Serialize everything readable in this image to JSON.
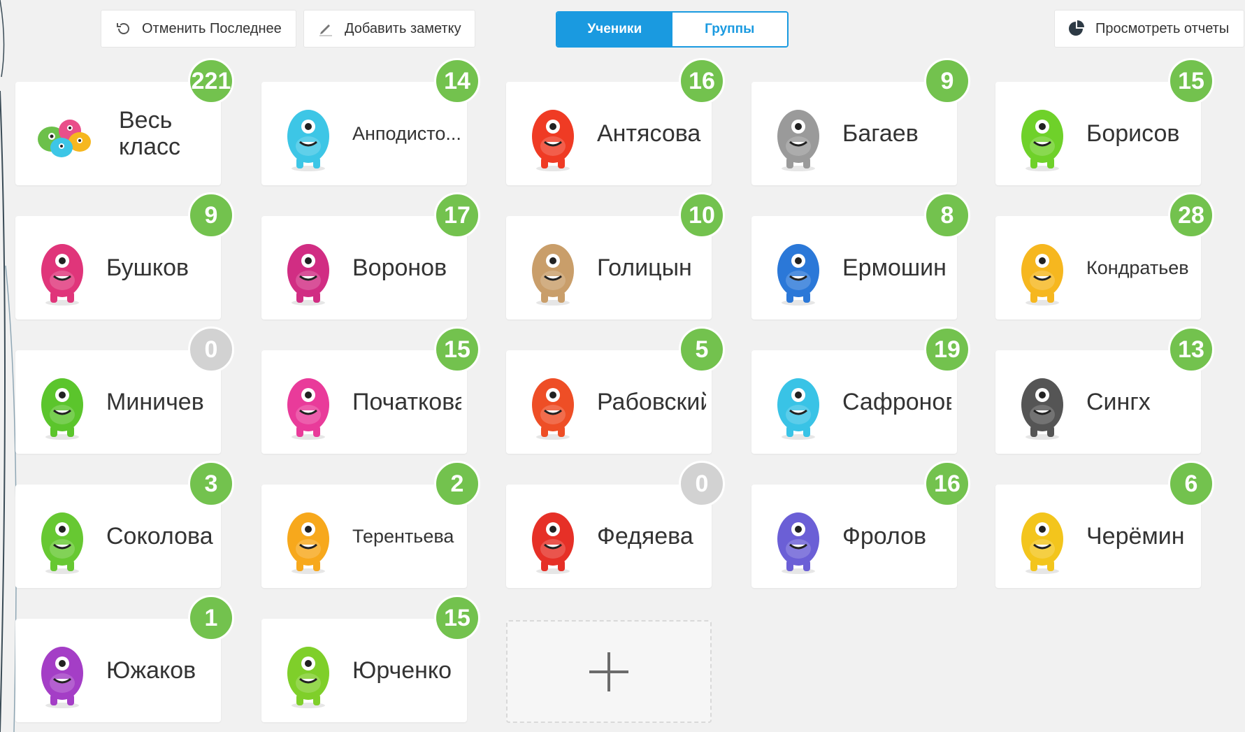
{
  "toolbar": {
    "undo_label": "Отменить Последнее",
    "note_label": "Добавить заметку",
    "reports_label": "Просмотреть отчеты",
    "tab_students": "Ученики",
    "tab_groups": "Группы"
  },
  "colors": {
    "accent": "#1a9ae0",
    "badge_positive": "#73c24e",
    "badge_zero": "#d2d2d2"
  },
  "cards": [
    {
      "name": "Весь класс",
      "points": "221",
      "avatar": "whole-class-monsters",
      "color": "#6cc04a"
    },
    {
      "name": "Анподисто...",
      "points": "14",
      "avatar": "cyan-monster",
      "color": "#3dc6e6"
    },
    {
      "name": "Антясова",
      "points": "16",
      "avatar": "red-monster",
      "color": "#ef3b24"
    },
    {
      "name": "Багаев",
      "points": "9",
      "avatar": "gray-cow-monster",
      "color": "#9a9a9a"
    },
    {
      "name": "Борисов",
      "points": "15",
      "avatar": "green-alien-monster",
      "color": "#6fd12a"
    },
    {
      "name": "Бушков",
      "points": "9",
      "avatar": "pink-cyclops-monster",
      "color": "#e0357a"
    },
    {
      "name": "Воронов",
      "points": "17",
      "avatar": "magenta-monster",
      "color": "#d12d83"
    },
    {
      "name": "Голицын",
      "points": "10",
      "avatar": "cow-monster",
      "color": "#c99e6a"
    },
    {
      "name": "Ермошин",
      "points": "8",
      "avatar": "blue-monster",
      "color": "#2b78d8"
    },
    {
      "name": "Кондратьев",
      "points": "28",
      "avatar": "yellow-monster",
      "color": "#f6b71f"
    },
    {
      "name": "Миничев",
      "points": "0",
      "avatar": "green-fanged-monster",
      "color": "#5bc52c"
    },
    {
      "name": "Початкова",
      "points": "15",
      "avatar": "pink-furry-monster",
      "color": "#e93b9a"
    },
    {
      "name": "Рабовский",
      "points": "5",
      "avatar": "orange-monster",
      "color": "#ee4e26"
    },
    {
      "name": "Сафронов",
      "points": "19",
      "avatar": "light-blue-monster",
      "color": "#39c3e6"
    },
    {
      "name": "Сингх",
      "points": "13",
      "avatar": "dark-gray-monster",
      "color": "#555555"
    },
    {
      "name": "Соколова",
      "points": "3",
      "avatar": "green-three-eyed-monster",
      "color": "#67c832"
    },
    {
      "name": "Терентьева",
      "points": "2",
      "avatar": "yellow-cyclops-monster",
      "color": "#f7a81c"
    },
    {
      "name": "Федяева",
      "points": "0",
      "avatar": "red-penguin-monster",
      "color": "#e63027"
    },
    {
      "name": "Фролов",
      "points": "16",
      "avatar": "purple-spotted-monster",
      "color": "#6b5fd6"
    },
    {
      "name": "Черёмин",
      "points": "6",
      "avatar": "yellow-octopus-monster",
      "color": "#f3c51c"
    },
    {
      "name": "Южаков",
      "points": "1",
      "avatar": "purple-octopus-monster",
      "color": "#a43ec6"
    },
    {
      "name": "Юрченко",
      "points": "15",
      "avatar": "lime-monster",
      "color": "#7fcf2a"
    }
  ]
}
